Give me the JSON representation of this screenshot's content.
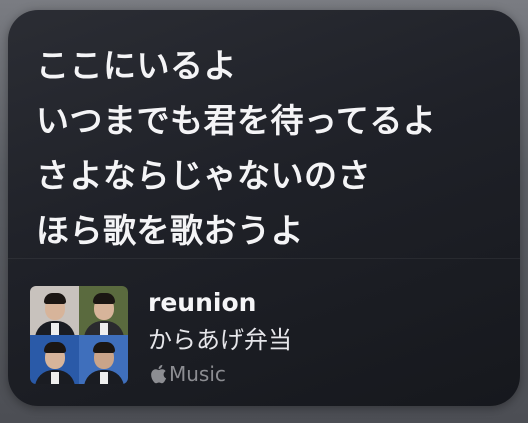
{
  "lyrics": {
    "lines": [
      "ここにいるよ",
      "いつまでも君を待ってるよ",
      "さよならじゃないのさ",
      "ほら歌を歌おうよ"
    ]
  },
  "now_playing": {
    "title": "reunion",
    "artist": "からあげ弁当",
    "service_label": "Music",
    "service_icon": "apple-logo-icon"
  },
  "colors": {
    "card_background": "#1f2128",
    "lyric_text": "#f4f4f6",
    "secondary_text": "#8c8d92"
  }
}
